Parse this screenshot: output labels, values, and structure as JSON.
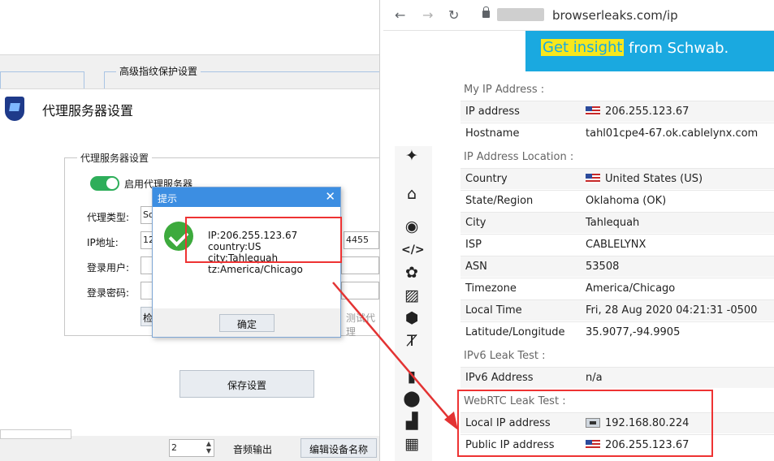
{
  "left_app": {
    "background_group_title": "高级指纹保护设置",
    "bottom": {
      "stepper_value": "2",
      "audio_output_label": "音频输出",
      "edit_device_name_button": "编辑设备名称"
    }
  },
  "proxy_window": {
    "title": "代理服务器设置",
    "group_title": "代理服务器设置",
    "enable_proxy_label": "启用代理服务器",
    "enable_proxy_on": true,
    "proxy_type_label": "代理类型:",
    "proxy_type_value": "So",
    "ip_label": "IP地址:",
    "ip_value": "12",
    "port_value": "4455",
    "user_label": "登录用户:",
    "password_label": "登录密码:",
    "check_button_fragment": "检",
    "test_button_fragment": "测试代理",
    "save_button": "保存设置"
  },
  "dialog": {
    "title": "提示",
    "lines": [
      "IP:206.255.123.67",
      "country:US",
      "city:Tahlequah",
      "tz:America/Chicago"
    ],
    "ok_button": "确定"
  },
  "browser": {
    "url": "browserleaks.com/ip",
    "ad": {
      "highlight": "Get insight",
      "rest": "from Schwab."
    },
    "sections": {
      "my_ip": "My IP Address :",
      "location": "IP Address Location :",
      "ipv6": "IPv6 Leak Test :",
      "webrtc": "WebRTC Leak Test :"
    },
    "rows": {
      "ip_address": {
        "label": "IP address",
        "value": "206.255.123.67"
      },
      "hostname": {
        "label": "Hostname",
        "value": "tahl01cpe4-67.ok.cablelynx.com"
      },
      "country": {
        "label": "Country",
        "value": "United States (US)"
      },
      "region": {
        "label": "State/Region",
        "value": "Oklahoma (OK)"
      },
      "city": {
        "label": "City",
        "value": "Tahlequah"
      },
      "isp": {
        "label": "ISP",
        "value": "CABLELYNX"
      },
      "asn": {
        "label": "ASN",
        "value": "53508"
      },
      "timezone": {
        "label": "Timezone",
        "value": "America/Chicago"
      },
      "local_time": {
        "label": "Local Time",
        "value": "Fri, 28 Aug 2020 04:21:31 -0500"
      },
      "latlon": {
        "label": "Latitude/Longitude",
        "value": "35.9077,-94.9905"
      },
      "ipv6_address": {
        "label": "IPv6 Address",
        "value": "n/a"
      },
      "local_ip": {
        "label": "Local IP address",
        "value": "192.168.80.224"
      },
      "public_ip": {
        "label": "Public IP address",
        "value": "206.255.123.67"
      }
    },
    "sidebar_icons": [
      "pin-icon",
      "home-icon",
      "broadcast-icon",
      "code-icon",
      "badge-icon",
      "image-icon",
      "cube-icon",
      "text-cursor-icon",
      "lock-icon",
      "map-marker-icon",
      "signal-bars-icon",
      "brick-wall-icon"
    ]
  },
  "colors": {
    "highlight_red": "#e33333",
    "toggle_green": "#2eae5a",
    "dialog_title_blue": "#3c8ee2",
    "ad_blue": "#1aa9e0",
    "ad_yellow": "#f8e71c"
  }
}
